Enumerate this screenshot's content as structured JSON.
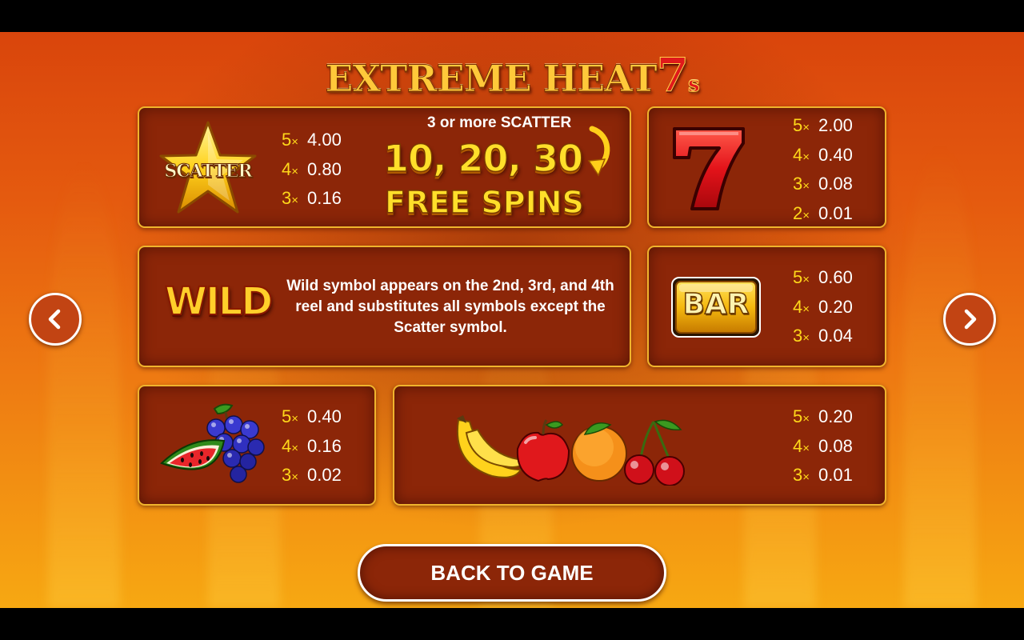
{
  "title": {
    "main": "EXTREME HEAT",
    "seven": "7",
    "suffix": "s"
  },
  "scatter": {
    "label": "SCATTER",
    "pays": [
      {
        "count": "5",
        "value": "4.00"
      },
      {
        "count": "4",
        "value": "0.80"
      },
      {
        "count": "3",
        "value": "0.16"
      }
    ],
    "free_spins_title": "3 or more SCATTER",
    "free_spins_numbers": "10, 20, 30",
    "free_spins_label": "FREE SPINS"
  },
  "seven": {
    "pays": [
      {
        "count": "5",
        "value": "2.00"
      },
      {
        "count": "4",
        "value": "0.40"
      },
      {
        "count": "3",
        "value": "0.08"
      },
      {
        "count": "2",
        "value": "0.01"
      }
    ]
  },
  "wild": {
    "label": "WILD",
    "description": "Wild symbol appears on the 2nd, 3rd, and 4th reel and substitutes all symbols except the Scatter symbol."
  },
  "bar": {
    "label": "BAR",
    "pays": [
      {
        "count": "5",
        "value": "0.60"
      },
      {
        "count": "4",
        "value": "0.20"
      },
      {
        "count": "3",
        "value": "0.04"
      }
    ]
  },
  "grapes_watermelon": {
    "pays": [
      {
        "count": "5",
        "value": "0.40"
      },
      {
        "count": "4",
        "value": "0.16"
      },
      {
        "count": "3",
        "value": "0.02"
      }
    ]
  },
  "fruits": {
    "pays": [
      {
        "count": "5",
        "value": "0.20"
      },
      {
        "count": "4",
        "value": "0.08"
      },
      {
        "count": "3",
        "value": "0.01"
      }
    ]
  },
  "multiplier_sign": "×",
  "buttons": {
    "back_to_game": "BACK TO GAME"
  },
  "icons": {
    "prev": "chevron-left-icon",
    "next": "chevron-right-icon"
  }
}
